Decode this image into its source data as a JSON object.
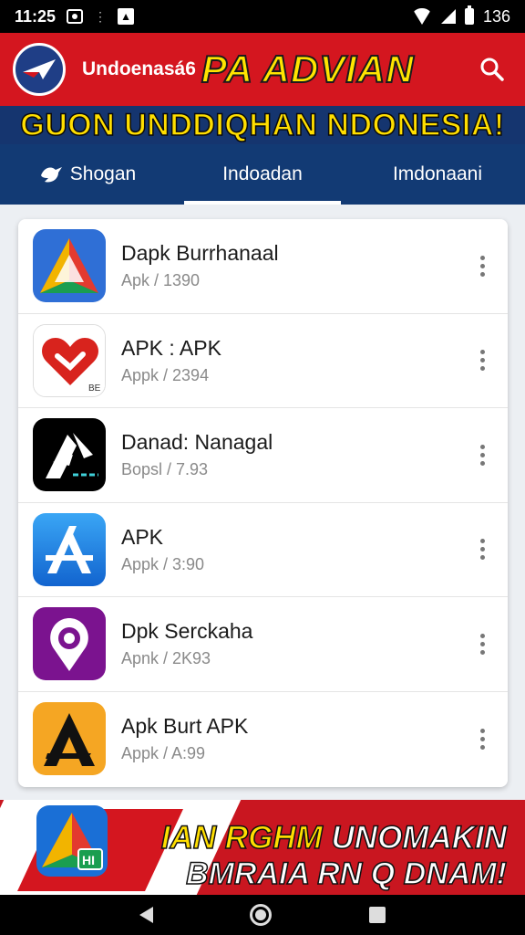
{
  "status_bar": {
    "time": "11:25",
    "battery": "136"
  },
  "app_bar": {
    "name": "Undoenasá6",
    "headline": "PA ADVIAN"
  },
  "banner": {
    "text": "GUON UNDDIQHAN NDONESIA!"
  },
  "tabs": [
    {
      "label": "Shogan",
      "icon": "bird-icon",
      "active": false
    },
    {
      "label": "Indoadan",
      "active": true
    },
    {
      "label": "Imdonaani",
      "active": false
    }
  ],
  "apps": [
    {
      "title": "Dapk Burrhanaal",
      "sub": "Apk / 1390",
      "icon": "triangle-app-icon"
    },
    {
      "title": "APK : APK",
      "sub": "Appk / 2394",
      "icon": "heart-app-icon"
    },
    {
      "title": "Danad: Nanagal",
      "sub": "Bopsl / 7.93",
      "icon": "arrows-app-icon"
    },
    {
      "title": "APK",
      "sub": "Appk / 3:90",
      "icon": "store-app-icon"
    },
    {
      "title": "Dpk Serckaha",
      "sub": "Apnk / 2K93",
      "icon": "location-pin-app-icon"
    },
    {
      "title": "Apk Burt APK",
      "sub": "Appk / A:99",
      "icon": "letter-a-app-icon"
    }
  ],
  "promo": {
    "line1_a": "IAN RGHM",
    "line1_b": "UNOMAKIN",
    "line2": "BMRAIA RN Q DNAM!"
  },
  "colors": {
    "red": "#d4161f",
    "navy": "#123a74",
    "yellow": "#ffde00"
  }
}
